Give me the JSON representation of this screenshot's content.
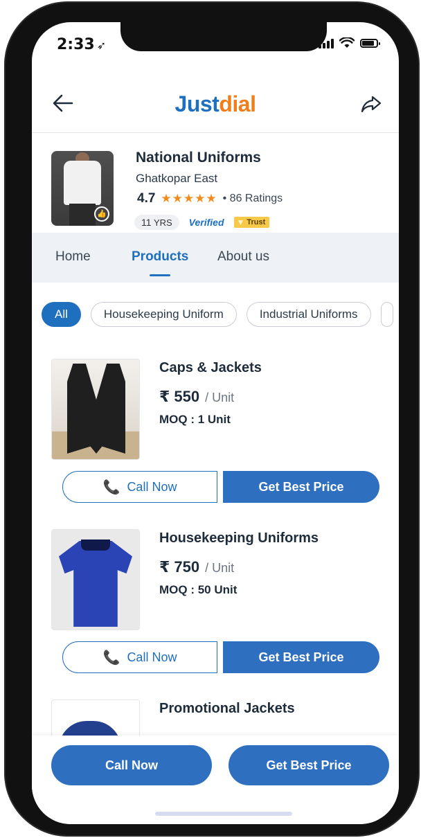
{
  "status_bar": {
    "time": "2:33",
    "location_arrow": "➤"
  },
  "header": {
    "logo_just": "Just",
    "logo_dial": "dial",
    "back_icon": "back-arrow-icon",
    "share_icon": "share-icon"
  },
  "business": {
    "name": "National Uniforms",
    "location": "Ghatkopar East",
    "rating": "4.7",
    "stars": "★★★★★",
    "ratings_count": "• 86 Ratings",
    "years_number": "11",
    "years_label": "YRS",
    "verified": "Verified",
    "trust": "Trust"
  },
  "tabs": [
    {
      "label": "Home",
      "active": false
    },
    {
      "label": "Products",
      "active": true
    },
    {
      "label": "About us",
      "active": false
    }
  ],
  "chips": [
    {
      "label": "All",
      "active": true
    },
    {
      "label": "Housekeeping Uniform",
      "active": false
    },
    {
      "label": "Industrial Uniforms",
      "active": false
    }
  ],
  "products": [
    {
      "title": "Caps & Jackets",
      "price": "₹ 550",
      "unit": "/ Unit",
      "moq": "MOQ : 1 Unit",
      "image": "vest"
    },
    {
      "title": "Housekeeping Uniforms",
      "price": "₹ 750",
      "unit": "/ Unit",
      "moq": "MOQ : 50 Unit",
      "image": "shirt"
    },
    {
      "title": "Promotional Jackets",
      "image": "jacket"
    }
  ],
  "buttons": {
    "call_now": "Call Now",
    "get_best_price": "Get Best Price"
  },
  "bottom_bar": {
    "call_now": "Call Now",
    "get_best_price": "Get Best Price"
  },
  "colors": {
    "brand_blue": "#1f6fbf",
    "brand_orange": "#f07e1b",
    "button_blue": "#2f6fc0",
    "star_orange": "#f28b1e"
  }
}
